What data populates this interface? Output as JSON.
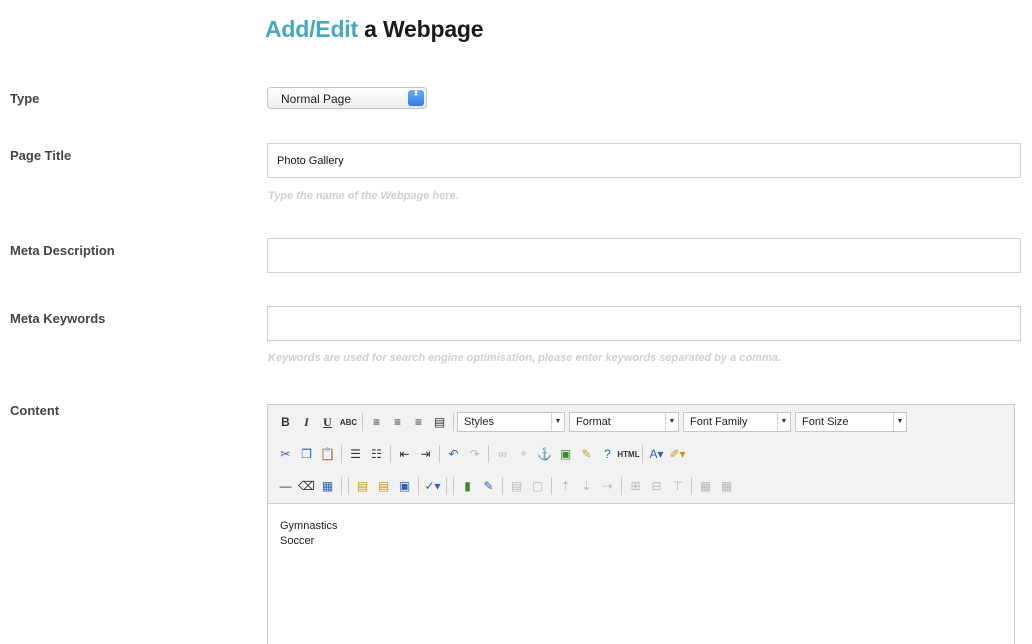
{
  "header": {
    "title_accent": "Add/Edit",
    "title_rest": "a Webpage"
  },
  "form": {
    "type": {
      "label": "Type",
      "value": "Normal Page",
      "arrow_glyph": "⬍"
    },
    "page_title": {
      "label": "Page Title",
      "value": "Photo Gallery",
      "hint": "Type the name of the Webpage here."
    },
    "meta_description": {
      "label": "Meta Description",
      "value": ""
    },
    "meta_keywords": {
      "label": "Meta Keywords",
      "value": "",
      "hint": "Keywords are used for search engine optimisation, please enter keywords separated by a comma."
    },
    "content": {
      "label": "Content",
      "lines": [
        "Gymnastics",
        "Soccer"
      ]
    }
  },
  "editor": {
    "row1": [
      {
        "name": "bold-button",
        "glyph": "B",
        "cls": "b"
      },
      {
        "name": "italic-button",
        "glyph": "I",
        "cls": "i"
      },
      {
        "name": "underline-button",
        "glyph": "U",
        "cls": "u"
      },
      {
        "name": "strikethrough-button",
        "glyph": "ABC",
        "cls": "small"
      },
      {
        "sep": true
      },
      {
        "name": "align-left-button",
        "glyph": "≡"
      },
      {
        "name": "align-center-button",
        "glyph": "≡"
      },
      {
        "name": "align-right-button",
        "glyph": "≡"
      },
      {
        "name": "align-justify-button",
        "glyph": "▤"
      },
      {
        "sep": true
      }
    ],
    "dropdowns": [
      {
        "name": "styles-dropdown",
        "label": "Styles",
        "width": 108
      },
      {
        "name": "format-dropdown",
        "label": "Format",
        "width": 110
      },
      {
        "name": "font-family-dropdown",
        "label": "Font Family",
        "width": 108
      },
      {
        "name": "font-size-dropdown",
        "label": "Font Size",
        "width": 112
      }
    ],
    "dd_arrow": "▼",
    "row2": [
      {
        "name": "cut-icon",
        "glyph": "✂",
        "cls": "blue"
      },
      {
        "name": "copy-icon",
        "glyph": "❐",
        "cls": "blue"
      },
      {
        "name": "paste-icon",
        "glyph": "📋",
        "cls": "gold"
      },
      {
        "sep": true
      },
      {
        "name": "bullet-list-icon",
        "glyph": "☰"
      },
      {
        "name": "numbered-list-icon",
        "glyph": "☷"
      },
      {
        "sep": true
      },
      {
        "name": "outdent-icon",
        "glyph": "⇤"
      },
      {
        "name": "indent-icon",
        "glyph": "⇥"
      },
      {
        "sep": true
      },
      {
        "name": "undo-icon",
        "glyph": "↶",
        "cls": "blue"
      },
      {
        "name": "redo-icon",
        "glyph": "↷",
        "cls": "gray"
      },
      {
        "sep": true
      },
      {
        "name": "link-icon",
        "glyph": "∞",
        "cls": "gray"
      },
      {
        "name": "unlink-icon",
        "glyph": "⚬",
        "cls": "gray"
      },
      {
        "name": "anchor-icon",
        "glyph": "⚓",
        "cls": "blue"
      },
      {
        "name": "image-icon",
        "glyph": "▣",
        "cls": "green"
      },
      {
        "name": "cleanup-icon",
        "glyph": "✎",
        "cls": "gold"
      },
      {
        "name": "help-icon",
        "glyph": "?",
        "cls": "blue"
      },
      {
        "name": "html-icon",
        "glyph": "HTML",
        "cls": "small"
      },
      {
        "sep": true
      },
      {
        "name": "text-color-icon",
        "glyph": "A▾",
        "cls": "blue"
      },
      {
        "name": "background-color-icon",
        "glyph": "✐▾",
        "cls": "gold"
      }
    ],
    "row3": [
      {
        "name": "horizontal-rule-icon",
        "glyph": "—"
      },
      {
        "name": "remove-format-icon",
        "glyph": "⌫"
      },
      {
        "name": "visual-aid-icon",
        "glyph": "▦",
        "cls": "blue"
      },
      {
        "sep": true
      },
      {
        "sep": true
      },
      {
        "name": "paste-text-icon",
        "glyph": "▤",
        "cls": "gold"
      },
      {
        "name": "paste-word-icon",
        "glyph": "▤",
        "cls": "gold"
      },
      {
        "name": "select-all-icon",
        "glyph": "▣",
        "cls": "blue"
      },
      {
        "sep": true
      },
      {
        "name": "spellcheck-icon",
        "glyph": "✓▾",
        "cls": "blue"
      },
      {
        "sep": true
      },
      {
        "sep": true
      },
      {
        "name": "media-icon",
        "glyph": "▮",
        "cls": "green"
      },
      {
        "name": "edit-image-icon",
        "glyph": "✎",
        "cls": "blue"
      },
      {
        "sep": true
      },
      {
        "name": "table-icon",
        "glyph": "▤",
        "cls": "gray"
      },
      {
        "name": "table-props-icon",
        "glyph": "▢",
        "cls": "gray"
      },
      {
        "sep": true
      },
      {
        "name": "row-insert-icon",
        "glyph": "⇡",
        "cls": "gray"
      },
      {
        "name": "row-delete-icon",
        "glyph": "⇣",
        "cls": "gray"
      },
      {
        "name": "col-insert-icon",
        "glyph": "⇢",
        "cls": "gray"
      },
      {
        "sep": true
      },
      {
        "name": "merge-cells-icon",
        "glyph": "⊞",
        "cls": "gray"
      },
      {
        "name": "split-cells-icon",
        "glyph": "⊟",
        "cls": "gray"
      },
      {
        "name": "cell-props-icon",
        "glyph": "⊤",
        "cls": "gray"
      },
      {
        "sep": true
      },
      {
        "name": "grid-icon",
        "glyph": "▦",
        "cls": "gray"
      },
      {
        "name": "table-delete-icon",
        "glyph": "▦",
        "cls": "gray"
      }
    ]
  },
  "colors": {
    "accent": "#45a8bf",
    "hint": "#cfcfcf",
    "toolbar_bg": "#f2f2f2"
  }
}
